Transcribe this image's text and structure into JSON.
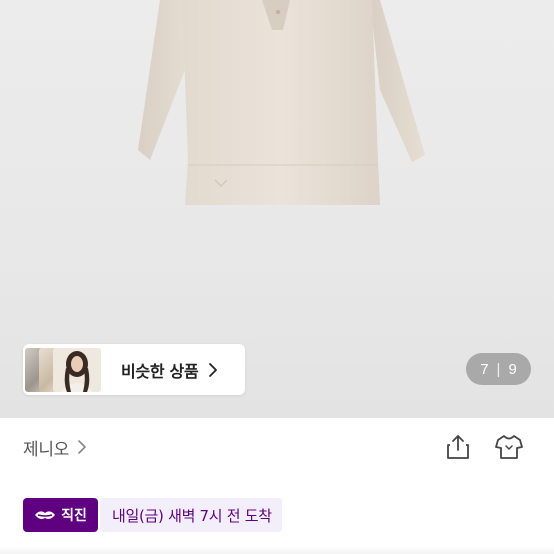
{
  "gallery": {
    "similar_products_label": "비슷한 상품",
    "counter": {
      "current": "7",
      "separator": "|",
      "total": "9"
    }
  },
  "brand": {
    "name": "제니오"
  },
  "delivery": {
    "badge_label": "직진",
    "text": "내일(금) 새벽 7시 전 도착"
  },
  "icons": {
    "share": "share-icon",
    "wishlist": "clothes-hanger-icon",
    "brand_chevron": "chevron-right-icon",
    "similar_chevron": "chevron-right-icon",
    "badge": "lips-logo-icon"
  },
  "colors": {
    "accent": "#5f0080",
    "delivery_bg": "#f3effa",
    "counter_bg": "#787878"
  }
}
